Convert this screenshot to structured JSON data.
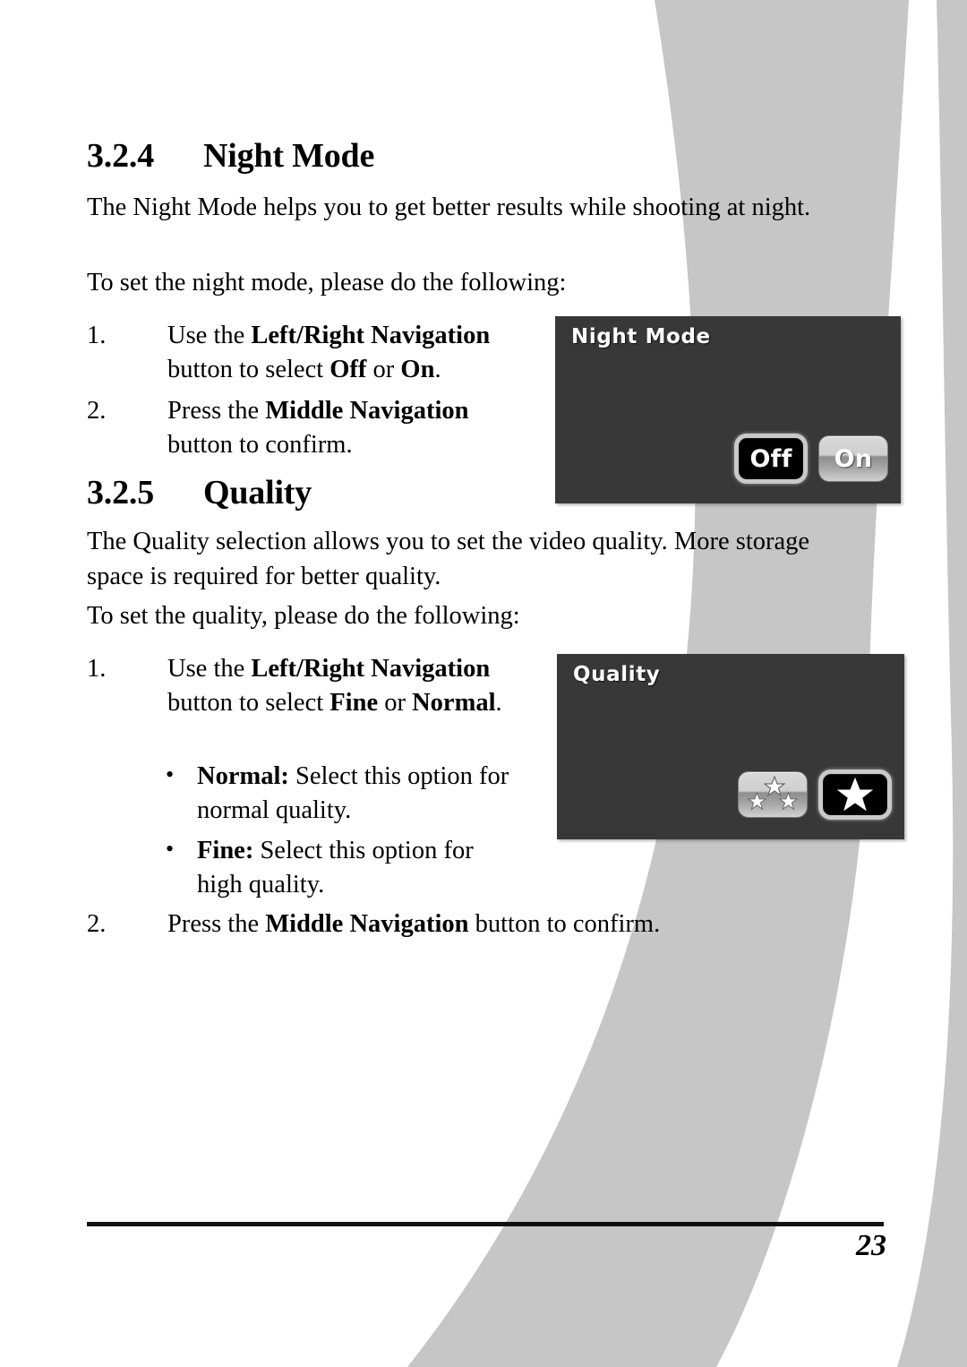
{
  "page": {
    "number": "23",
    "background_color": "#ffffff",
    "decor_color": "#c6c6c6"
  },
  "sections": [
    {
      "number": "3.2.4",
      "title": "Night Mode",
      "intro": "The Night Mode helps you to get better results while shooting at night.",
      "lead_in": "To set the night mode, please do the following:",
      "steps": [
        {
          "marker": "1.",
          "parts": [
            {
              "text": "Use the ",
              "bold": false
            },
            {
              "text": "Left/Right Navigation",
              "bold": true
            },
            {
              "text": " button to select ",
              "bold": false
            },
            {
              "text": "Off",
              "bold": true
            },
            {
              "text": " or ",
              "bold": false
            },
            {
              "text": "On",
              "bold": true
            },
            {
              "text": ".",
              "bold": false
            }
          ]
        },
        {
          "marker": "2.",
          "parts": [
            {
              "text": "Press the ",
              "bold": false
            },
            {
              "text": "Middle Navigation",
              "bold": true
            },
            {
              "text": " button to confirm.",
              "bold": false
            }
          ]
        }
      ]
    },
    {
      "number": "3.2.5",
      "title": "Quality",
      "intro": "The Quality selection allows you to set the video quality. More storage space is required for better quality.",
      "lead_in": "To set the quality, please do the following:",
      "steps": [
        {
          "marker": "1.",
          "parts": [
            {
              "text": "Use the ",
              "bold": false
            },
            {
              "text": "Left/Right Navigation",
              "bold": true
            },
            {
              "text": " button to select ",
              "bold": false
            },
            {
              "text": "Fine",
              "bold": true
            },
            {
              "text": " or ",
              "bold": false
            },
            {
              "text": "Normal",
              "bold": true
            },
            {
              "text": ".",
              "bold": false
            }
          ]
        },
        {
          "marker": "2.",
          "parts": [
            {
              "text": "Press the ",
              "bold": false
            },
            {
              "text": "Middle Navigation",
              "bold": true
            },
            {
              "text": " button to confirm.",
              "bold": false
            }
          ]
        }
      ],
      "bullets": [
        {
          "glyph": "•",
          "parts": [
            {
              "text": "Normal:",
              "bold": true
            },
            {
              "text": " Select this option for normal quality.",
              "bold": false
            }
          ]
        },
        {
          "glyph": "•",
          "parts": [
            {
              "text": "Fine:",
              "bold": true
            },
            {
              "text": " Select this option for high quality.",
              "bold": false
            }
          ]
        }
      ]
    }
  ],
  "device_panels": [
    {
      "id": "night-mode",
      "title": "Night Mode",
      "background_color": "#383838",
      "title_color": "#ffffff",
      "options": [
        {
          "label": "Off",
          "selected": true,
          "icon": "none"
        },
        {
          "label": "On",
          "selected": false,
          "icon": "none"
        }
      ]
    },
    {
      "id": "quality",
      "title": "Quality",
      "background_color": "#383838",
      "title_color": "#ffffff",
      "options": [
        {
          "label": "",
          "selected": false,
          "icon": "three-stars-icon"
        },
        {
          "label": "",
          "selected": true,
          "icon": "single-star-icon"
        }
      ]
    }
  ]
}
